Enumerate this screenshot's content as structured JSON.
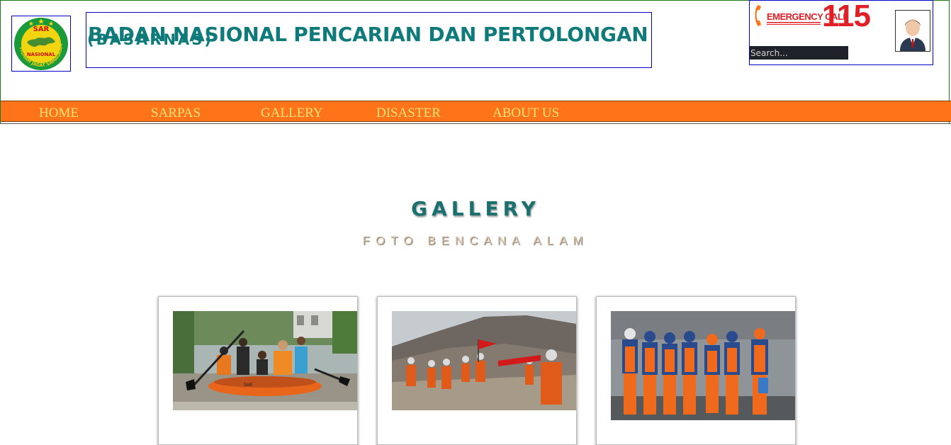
{
  "header": {
    "title": "BADAN NASIONAL PENCARIAN DAN PERTOLONGAN",
    "subtitle": "(BASARNAS)",
    "logo": {
      "top_text": "SAR",
      "middle_text": "NASIONAL",
      "ring_text": "AVIGNAM JAGAT SAMAGRAM",
      "colors": {
        "ring": "#1a9a3a",
        "field": "#f2d411",
        "text": "#d01010"
      }
    },
    "emergency": {
      "label": "EMERGENCY CALL",
      "number": "115",
      "color": "#e01f26"
    },
    "search": {
      "placeholder": "Search..."
    },
    "avatar": {
      "icon": "user-avatar-icon"
    }
  },
  "nav": {
    "items": [
      {
        "label": "HOME"
      },
      {
        "label": "SARPAS"
      },
      {
        "label": "GALLERY"
      },
      {
        "label": "DISASTER"
      },
      {
        "label": "ABOUT US"
      }
    ],
    "colors": {
      "bar": "#ff7418",
      "text": "#ffe37a"
    }
  },
  "gallery": {
    "heading": "GALLERY",
    "subheading": "FOTO BENCANA ALAM",
    "cards": [
      {
        "image": "flood-rescue-raft-photo"
      },
      {
        "image": "landslide-rescue-team-photo"
      },
      {
        "image": "earthquake-rescue-team-photo"
      }
    ]
  },
  "theme": {
    "accent": "#0e7a7a",
    "navbar": "#ff7418"
  }
}
